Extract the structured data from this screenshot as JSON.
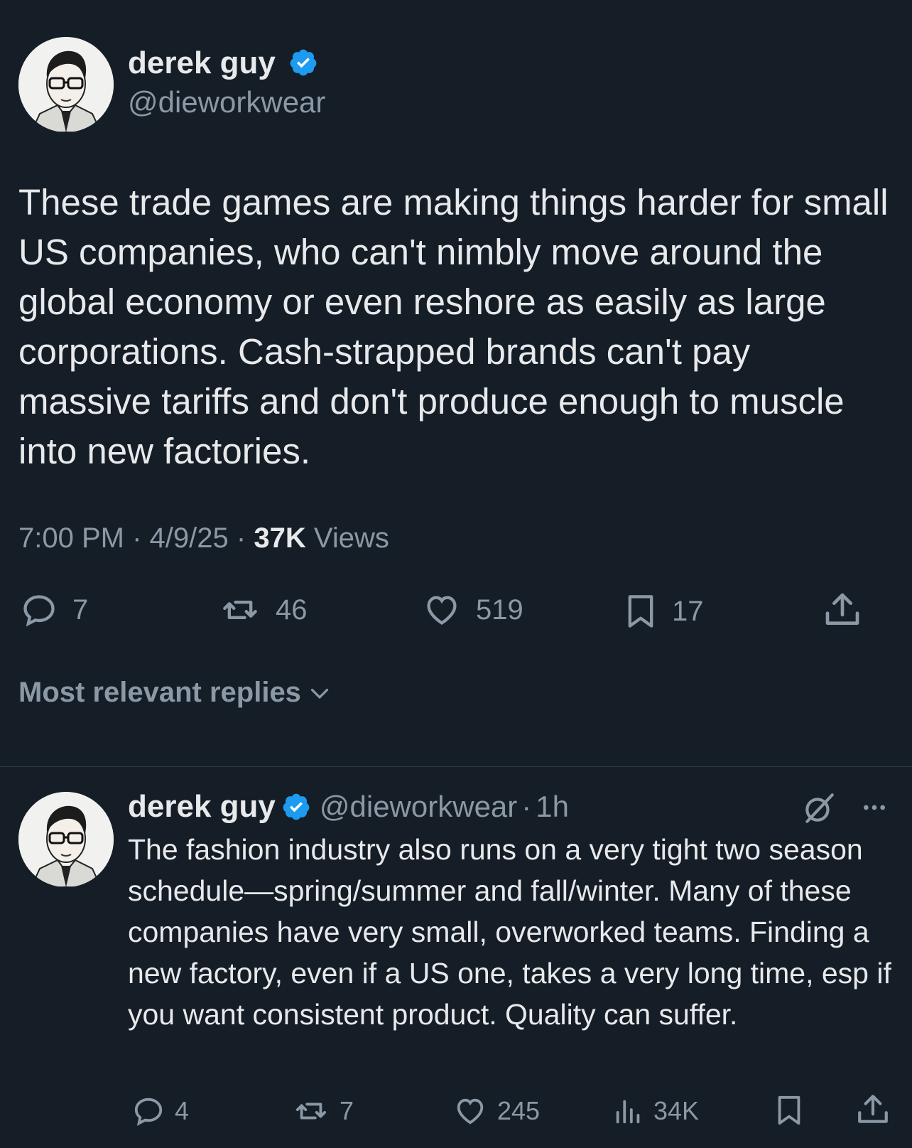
{
  "tweet": {
    "author_name": "derek guy",
    "author_handle": "@dieworkwear",
    "text": "These trade games are making things harder for small US companies, who can't nimbly move around the global economy or even reshore as easily as large corporations. Cash-strapped brands can't pay massive tariffs and don't produce enough to muscle into new factories.",
    "time": "7:00 PM",
    "date": "4/9/25",
    "views_count": "37K",
    "views_label": "Views",
    "separator": "·",
    "replies": "7",
    "reposts": "46",
    "likes": "519",
    "bookmarks": "17"
  },
  "sort": {
    "label": "Most relevant replies"
  },
  "reply": {
    "author_name": "derek guy",
    "author_handle": "@dieworkwear",
    "age": "1h",
    "separator": "·",
    "text": "The fashion industry also runs on a very tight two season schedule—spring/summer and fall/winter. Many of these companies have very small, overworked teams. Finding a new factory, even if a US one, takes a very long time, esp if you want consistent product. Quality can suffer.",
    "replies": "4",
    "reposts": "7",
    "likes": "245",
    "views": "34K"
  },
  "colors": {
    "background": "#151d27",
    "text": "#e7e9ea",
    "muted": "#8b98a5",
    "verified": "#1d9bf0",
    "divider": "#2f3943"
  },
  "icons": {
    "reply": "speech-bubble-icon",
    "repost": "repost-arrows-icon",
    "like": "heart-icon",
    "bookmark": "bookmark-icon",
    "share": "share-upload-icon",
    "views": "bar-chart-icon",
    "grok": "grok-icon",
    "more": "more-dots-icon",
    "verified": "verified-badge-icon",
    "sort": "chevron-down-icon"
  }
}
